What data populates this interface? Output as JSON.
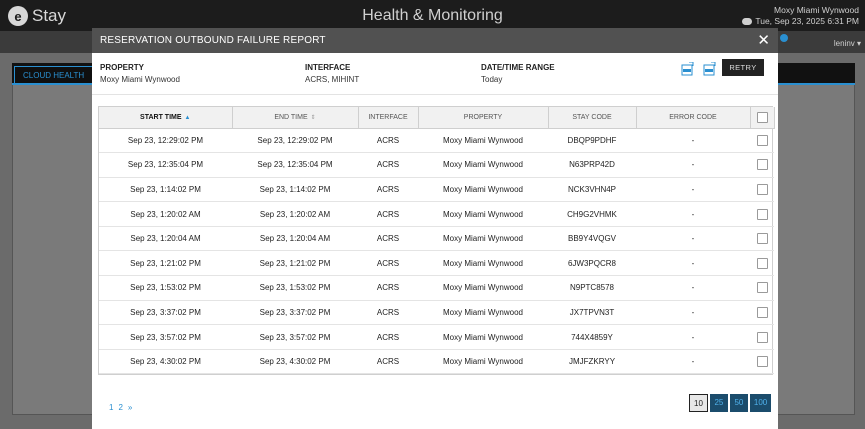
{
  "app": {
    "logo_mark": "e",
    "logo_text": "Stay",
    "title": "Health & Monitoring",
    "hotel": "Moxy Miami Wynwood",
    "datetime": "Tue, Sep 23, 2025 6:31 PM",
    "user": "leninv ▾",
    "tab": "CLOUD HEALTH"
  },
  "modal": {
    "title": "RESERVATION OUTBOUND FAILURE REPORT",
    "close": "✕",
    "property_label": "PROPERTY",
    "property_value": "Moxy Miami Wynwood",
    "interface_label": "INTERFACE",
    "interface_value": "ACRS, MIHINT",
    "range_label": "DATE/TIME RANGE",
    "range_value": "Today",
    "retry": "RETRY",
    "icons": [
      "excel-export-icon",
      "excel-export-all-icon"
    ]
  },
  "table": {
    "headers": [
      "START TIME",
      "END TIME",
      "INTERFACE",
      "PROPERTY",
      "STAY CODE",
      "ERROR CODE"
    ],
    "rows": [
      [
        "Sep 23, 12:29:02 PM",
        "Sep 23, 12:29:02 PM",
        "ACRS",
        "Moxy Miami Wynwood",
        "DBQP9PDHF",
        "-"
      ],
      [
        "Sep 23, 12:35:04 PM",
        "Sep 23, 12:35:04 PM",
        "ACRS",
        "Moxy Miami Wynwood",
        "N63PRP42D",
        "-"
      ],
      [
        "Sep 23, 1:14:02 PM",
        "Sep 23, 1:14:02 PM",
        "ACRS",
        "Moxy Miami Wynwood",
        "NCK3VHN4P",
        "-"
      ],
      [
        "Sep 23, 1:20:02 AM",
        "Sep 23, 1:20:02 AM",
        "ACRS",
        "Moxy Miami Wynwood",
        "CH9G2VHMK",
        "-"
      ],
      [
        "Sep 23, 1:20:04 AM",
        "Sep 23, 1:20:04 AM",
        "ACRS",
        "Moxy Miami Wynwood",
        "BB9Y4VQGV",
        "-"
      ],
      [
        "Sep 23, 1:21:02 PM",
        "Sep 23, 1:21:02 PM",
        "ACRS",
        "Moxy Miami Wynwood",
        "6JW3PQCR8",
        "-"
      ],
      [
        "Sep 23, 1:53:02 PM",
        "Sep 23, 1:53:02 PM",
        "ACRS",
        "Moxy Miami Wynwood",
        "N9PTC8578",
        "-"
      ],
      [
        "Sep 23, 3:37:02 PM",
        "Sep 23, 3:37:02 PM",
        "ACRS",
        "Moxy Miami Wynwood",
        "JX7TPVN3T",
        "-"
      ],
      [
        "Sep 23, 3:57:02 PM",
        "Sep 23, 3:57:02 PM",
        "ACRS",
        "Moxy Miami Wynwood",
        "744X4859Y",
        "-"
      ],
      [
        "Sep 23, 4:30:02 PM",
        "Sep 23, 4:30:02 PM",
        "ACRS",
        "Moxy Miami Wynwood",
        "JMJFZKRYY",
        "-"
      ]
    ]
  },
  "pagination": {
    "pages": [
      "1",
      "2",
      "»"
    ],
    "sizes": [
      "10",
      "25",
      "50",
      "100"
    ],
    "selected_size": "10"
  },
  "colors": {
    "accent": "#2a8fd0",
    "header_bar": "#515151",
    "dark": "#1c1c1c"
  }
}
